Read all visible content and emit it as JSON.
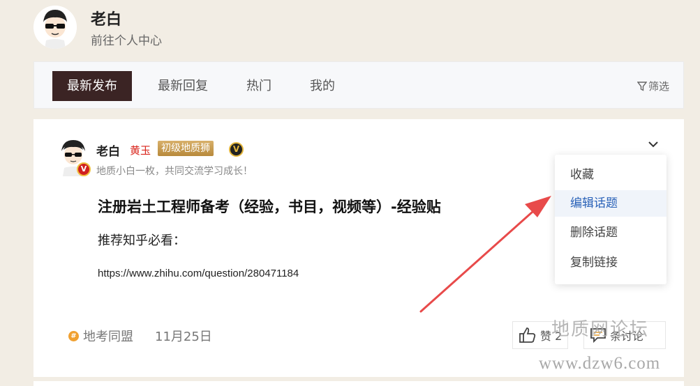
{
  "header": {
    "user_name": "老白",
    "profile_link": "前往个人中心"
  },
  "tabs": [
    {
      "label": "最新发布",
      "active": true
    },
    {
      "label": "最新回复",
      "active": false
    },
    {
      "label": "热门",
      "active": false
    },
    {
      "label": "我的",
      "active": false
    }
  ],
  "filter_label": "筛选",
  "post": {
    "author": "老白",
    "rank": "黄玉",
    "level": "初级地质狮",
    "verified_badge": "V",
    "avatar_badge": "V",
    "signature": "地质小白一枚，共同交流学习成长！",
    "title": "注册岩土工程师备考（经验，书目，视频等）-经验贴",
    "body": "推荐知乎必看：",
    "url": "https://www.zhihu.com/question/280471184",
    "tag": "地考同盟",
    "tag_icon": "#",
    "date": "11月25日",
    "like_label": "赞 2",
    "comment_label": "条讨论"
  },
  "menu": {
    "items": [
      "收藏",
      "编辑话题",
      "删除话题",
      "复制链接"
    ],
    "highlighted_index": 1
  },
  "watermark": {
    "line1": "地质网论坛",
    "line2": "www.dzw6.com"
  },
  "colors": {
    "page_bg": "#f2ede4",
    "active_tab": "#3b2424",
    "rank_red": "#d9251c",
    "level_gold": "#c89a4e",
    "menu_highlight": "#2a62b8",
    "arrow_red": "#e84a4a"
  }
}
